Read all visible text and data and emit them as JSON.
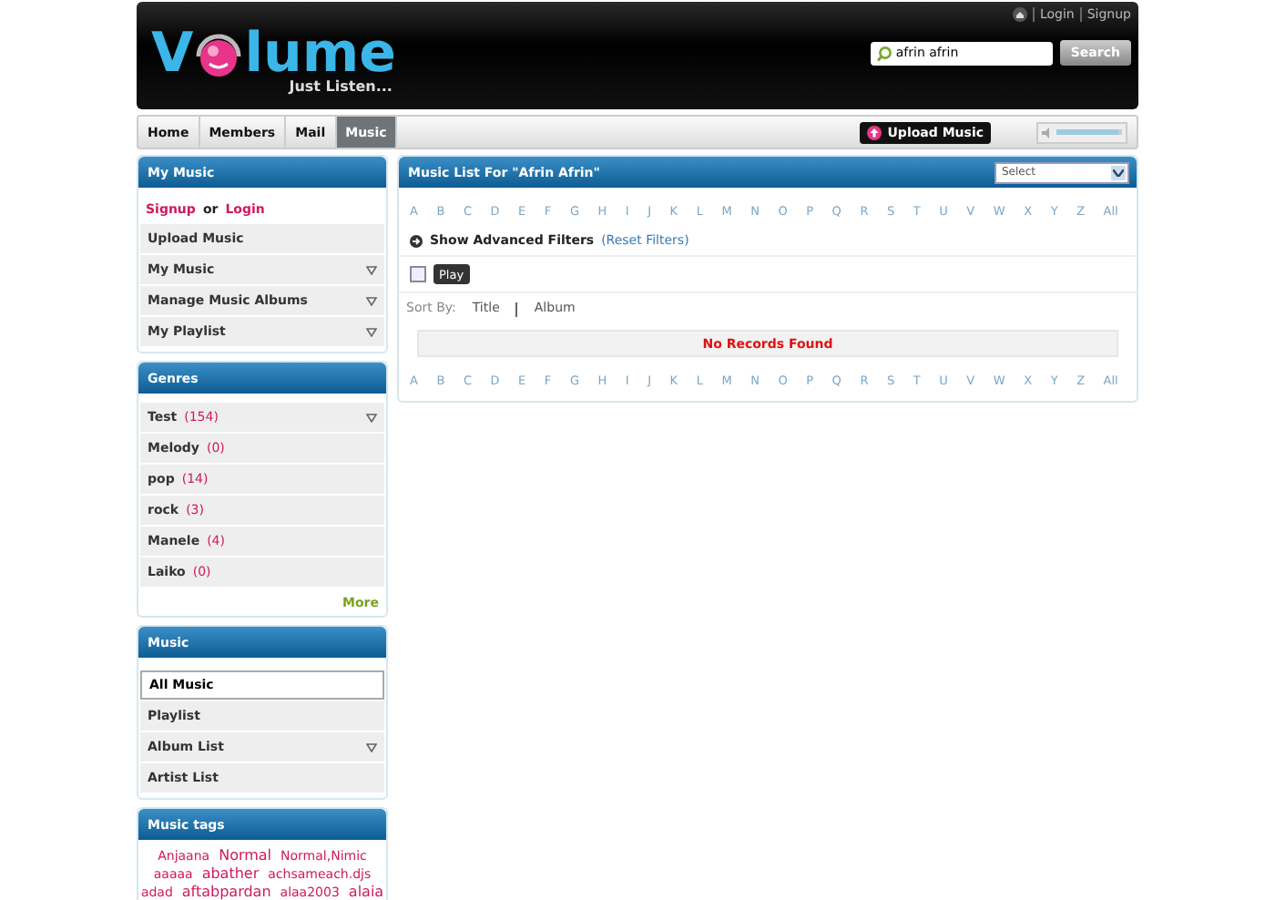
{
  "header": {
    "logo": {
      "before": "V",
      "after": "lume",
      "tagline": "Just Listen..."
    },
    "links": [
      "Login",
      "Signup"
    ],
    "search": {
      "value": "afrin afrin",
      "button": "Search"
    }
  },
  "nav": {
    "tabs": [
      {
        "label": "Home",
        "selected": false
      },
      {
        "label": "Members",
        "selected": false
      },
      {
        "label": "Mail",
        "selected": false
      },
      {
        "label": "Music",
        "selected": true
      }
    ],
    "upload": "Upload Music",
    "volume": {
      "level": 0.95
    }
  },
  "sidebar": {
    "panels": [
      {
        "title": "My Music",
        "kind": "menu",
        "auth": {
          "signup": "Signup",
          "or": "or",
          "login": "Login"
        },
        "items": [
          {
            "label": "Upload Music",
            "expandable": false,
            "selected": false
          },
          {
            "label": "My Music",
            "expandable": true,
            "selected": false
          },
          {
            "label": "Manage Music Albums",
            "expandable": true,
            "selected": false
          },
          {
            "label": "My Playlist",
            "expandable": true,
            "selected": false
          }
        ]
      },
      {
        "title": "Genres",
        "kind": "menu",
        "items": [
          {
            "label": "Test",
            "count": "(154)",
            "expandable": true,
            "selected": false
          },
          {
            "label": "Melody",
            "count": "(0)",
            "expandable": false,
            "selected": false
          },
          {
            "label": "pop",
            "count": "(14)",
            "expandable": false,
            "selected": false
          },
          {
            "label": "rock",
            "count": "(3)",
            "expandable": false,
            "selected": false
          },
          {
            "label": "Manele",
            "count": "(4)",
            "expandable": false,
            "selected": false
          },
          {
            "label": "Laiko",
            "count": "(0)",
            "expandable": false,
            "selected": false
          }
        ],
        "more": "More"
      },
      {
        "title": "Music",
        "kind": "menu",
        "items": [
          {
            "label": "All Music",
            "expandable": false,
            "selected": true
          },
          {
            "label": "Playlist",
            "expandable": false,
            "selected": false
          },
          {
            "label": "Album List",
            "expandable": true,
            "selected": false
          },
          {
            "label": "Artist List",
            "expandable": false,
            "selected": false
          }
        ]
      },
      {
        "title": "Music tags",
        "kind": "tags",
        "tags": [
          [
            "Anjaana",
            "Normal",
            "Normal,Nimic"
          ],
          [
            "aaaaa",
            "abather",
            "achsameach.djs"
          ],
          [
            "adad",
            "aftabpardan",
            "alaa2003",
            "alaia"
          ]
        ]
      }
    ]
  },
  "main": {
    "title": "Music List For \"Afrin Afrin\"",
    "select": "Select",
    "letters_top": [
      "A",
      "B",
      "C",
      "D",
      "E",
      "F",
      "G",
      "H",
      "I",
      "J",
      "K",
      "L",
      "M",
      "N",
      "O",
      "P",
      "Q",
      "R",
      "S",
      "T",
      "U",
      "V",
      "W",
      "X",
      "Y",
      "Z",
      "All"
    ],
    "letters_bottom": [
      "A",
      "B",
      "C",
      "D",
      "E",
      "F",
      "G",
      "H",
      "I",
      "J",
      "K",
      "L",
      "M",
      "N",
      "O",
      "P",
      "Q",
      "R",
      "S",
      "T",
      "U",
      "V",
      "W",
      "X",
      "Y",
      "Z",
      "All"
    ],
    "filters": {
      "label": "Show Advanced Filters",
      "reset": "(Reset Filters)"
    },
    "play": {
      "checked": false,
      "button": "Play"
    },
    "sort": {
      "label": "Sort By:",
      "options": [
        "Title",
        "Album"
      ]
    },
    "empty": "No Records Found"
  }
}
